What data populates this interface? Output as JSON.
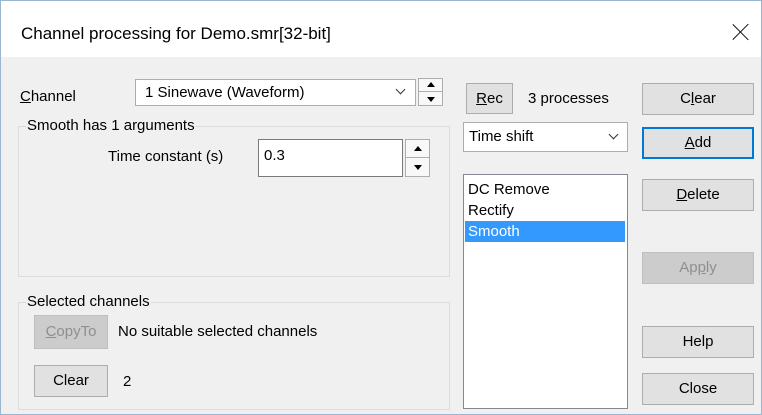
{
  "window": {
    "title": "Channel processing for Demo.smr[32-bit]",
    "close_glyph": "close-icon"
  },
  "channel": {
    "label": "Channel",
    "label_underline": "C",
    "label_rest": "hannel",
    "selected": "1 Sinewave (Waveform)"
  },
  "arguments_group": {
    "title": "Smooth has 1 arguments",
    "param_label": "Time constant (s)",
    "param_value": "0.3"
  },
  "selected_group": {
    "title": "Selected channels",
    "copyto_label": "CopyTo",
    "copyto_underline": "C",
    "copyto_rest": "opyTo",
    "message": "No suitable selected channels",
    "clear_label": "Clear",
    "count": "2"
  },
  "processes": {
    "rec_underline": "R",
    "rec_rest": "ec",
    "rec_label": "Rec",
    "count_text": "3 processes",
    "type_selected": "Time shift",
    "items": [
      "DC Remove",
      "Rectify",
      "Smooth"
    ],
    "selected_index": 2
  },
  "buttons": {
    "clear": {
      "label": "Clear",
      "pre": "C",
      "u": "l",
      "post": "ear"
    },
    "add": {
      "label": "Add",
      "pre": "",
      "u": "A",
      "post": "dd"
    },
    "delete": {
      "label": "Delete",
      "pre": "",
      "u": "D",
      "post": "elete"
    },
    "apply": {
      "label": "Apply",
      "pre": "Ap",
      "u": "p",
      "post": "ly"
    },
    "help": {
      "label": "Help"
    },
    "close": {
      "label": "Close"
    }
  },
  "colors": {
    "accent": "#0078d7",
    "selection": "#3399ff",
    "dialog_bg": "#f0f0f0"
  }
}
